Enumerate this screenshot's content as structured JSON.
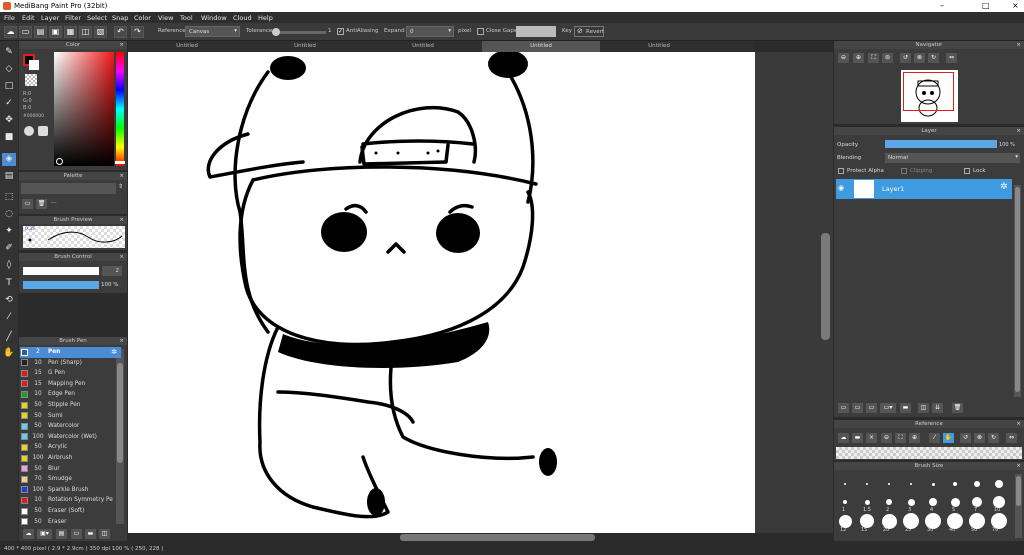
{
  "window": {
    "title": "MediBang Paint Pro (32bit)",
    "min": "–",
    "max": "□",
    "close": "×"
  },
  "menu": [
    "File",
    "Edit",
    "Layer",
    "Filter",
    "Select",
    "Snap",
    "Color",
    "View",
    "Tool",
    "Window",
    "Cloud",
    "Help"
  ],
  "toolbar": {
    "reference_label": "Reference",
    "reference_value": "Canvas",
    "tolerance_label": "Tolerance",
    "tolerance_value": "1",
    "antialias_label": "AntiAliasing",
    "expand_label": "Expand",
    "expand_value": "0",
    "pixel_label": "pixel",
    "closegaps_label": "Close Gaps",
    "key_label": "Key",
    "revert_label": "Revert"
  },
  "tabs": [
    "Untitled",
    "Untitled",
    "Untitled",
    "Untitled",
    "Untitled"
  ],
  "active_tab": 3,
  "color_panel": {
    "title": "Color",
    "r": "R:0",
    "g": "G:0",
    "b": "B:0",
    "hex": "#000000"
  },
  "palette_panel": {
    "title": "Palette"
  },
  "brush_preview_panel": {
    "title": "Brush Preview",
    "size": "0.35"
  },
  "brush_control_panel": {
    "title": "Brush Control",
    "size_value": "2",
    "opacity_value": "100 %"
  },
  "brush_panel": {
    "title": "Brush Pen",
    "items": [
      {
        "size": "2",
        "name": "Pen",
        "color": "#3a5a8a"
      },
      {
        "size": "10",
        "name": "Pen (Sharp)",
        "color": "#222222"
      },
      {
        "size": "15",
        "name": "G Pen",
        "color": "#e01b1b"
      },
      {
        "size": "15",
        "name": "Mapping Pen",
        "color": "#e01b1b"
      },
      {
        "size": "10",
        "name": "Edge Pen",
        "color": "#1fa01f"
      },
      {
        "size": "50",
        "name": "Stipple Pen",
        "color": "#e8d51a"
      },
      {
        "size": "50",
        "name": "Sumi",
        "color": "#e8d51a"
      },
      {
        "size": "50",
        "name": "Watercolor",
        "color": "#5fd0f0"
      },
      {
        "size": "100",
        "name": "Watercolor (Wet)",
        "color": "#5fd0f0"
      },
      {
        "size": "50",
        "name": "Acrylic",
        "color": "#e8d51a"
      },
      {
        "size": "100",
        "name": "Airbrush",
        "color": "#e8d51a"
      },
      {
        "size": "50",
        "name": "Blur",
        "color": "#f0a0e0"
      },
      {
        "size": "70",
        "name": "Smudge",
        "color": "#f0d090"
      },
      {
        "size": "100",
        "name": "Sparkle Brush",
        "color": "#2040d0"
      },
      {
        "size": "10",
        "name": "Rotation Symmetry Pe",
        "color": "#e01b1b"
      },
      {
        "size": "50",
        "name": "Eraser (Soft)",
        "color": "#ffffff"
      },
      {
        "size": "50",
        "name": "Eraser",
        "color": "#ffffff"
      }
    ]
  },
  "navigator_panel": {
    "title": "Navigator"
  },
  "layer_panel": {
    "title": "Layer",
    "opacity_label": "Opacity",
    "opacity_value": "100 %",
    "blending_label": "Blending",
    "blending_value": "Normal",
    "protect_alpha": "Protect Alpha",
    "clipping": "Clipping",
    "lock": "Lock",
    "layer_name": "Layer1"
  },
  "reference_panel": {
    "title": "Reference"
  },
  "brushsize_panel": {
    "title": "Brush Size",
    "row1_labels": [
      "1",
      "1.5",
      "2",
      "3",
      "4",
      "5",
      "7",
      "10"
    ],
    "row2_labels": [
      "12",
      "15",
      "20",
      "25",
      "30",
      "40",
      "50",
      "70"
    ]
  },
  "statusbar": {
    "text": "400 * 400 pixel  ( 2.9 * 2.9cm )  350 dpi  100 %  ( 250, 228 )"
  }
}
